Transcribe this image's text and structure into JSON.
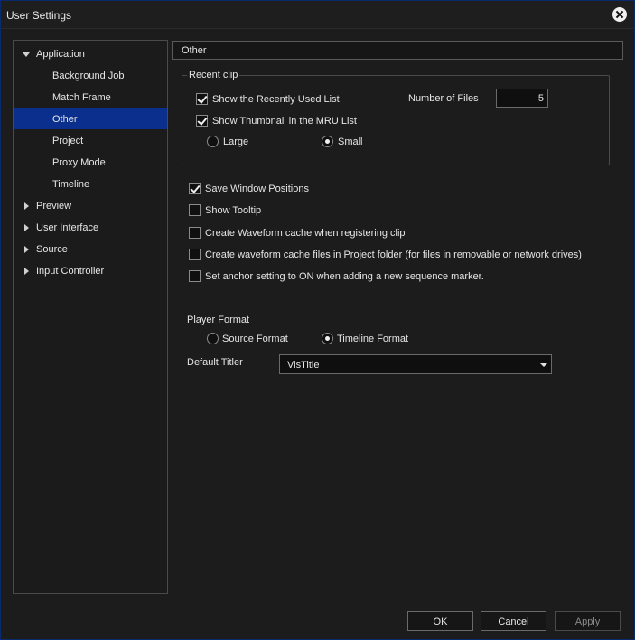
{
  "window": {
    "title": "User Settings"
  },
  "tree": {
    "application": "Application",
    "children": [
      "Background Job",
      "Match Frame",
      "Other",
      "Project",
      "Proxy Mode",
      "Timeline"
    ],
    "collapsed": [
      "Preview",
      "User Interface",
      "Source",
      "Input Controller"
    ],
    "selected": "Other"
  },
  "panel": {
    "header": "Other",
    "recent_clip": {
      "legend": "Recent clip",
      "show_recent": {
        "label": "Show the Recently Used List",
        "checked": true
      },
      "show_thumbnail": {
        "label": "Show Thumbnail in the MRU List",
        "checked": true
      },
      "number_of_files_label": "Number of Files",
      "number_of_files": "5",
      "size_large": "Large",
      "size_small": "Small",
      "size_selected": "Small"
    },
    "options": [
      {
        "label": "Save Window Positions",
        "checked": true
      },
      {
        "label": "Show Tooltip",
        "checked": false
      },
      {
        "label": "Create Waveform cache when registering clip",
        "checked": false
      },
      {
        "label": "Create waveform cache files in Project folder (for files in removable or network drives)",
        "checked": false
      },
      {
        "label": "Set anchor setting to ON when adding a new sequence marker.",
        "checked": false
      }
    ],
    "player_format": {
      "label": "Player Format",
      "source": "Source Format",
      "timeline": "Timeline Format",
      "selected": "Timeline Format"
    },
    "default_titler": {
      "label": "Default Titler",
      "value": "VisTitle"
    }
  },
  "buttons": {
    "ok": "OK",
    "cancel": "Cancel",
    "apply": "Apply"
  }
}
